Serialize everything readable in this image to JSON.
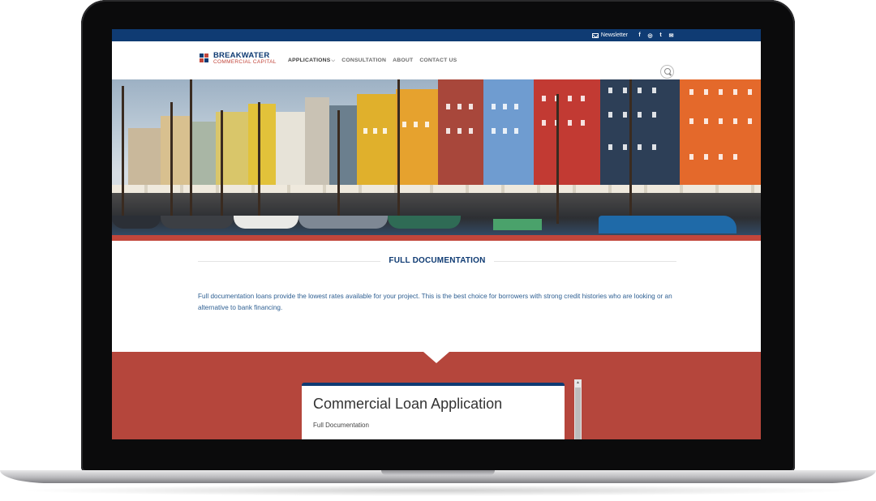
{
  "topbar": {
    "newsletter_label": "Newsletter",
    "social": [
      "f",
      "◎",
      "t",
      "✉"
    ]
  },
  "brand": {
    "name": "BREAKWATER",
    "tagline": "COMMERCIAL CAPITAL"
  },
  "nav": {
    "items": [
      {
        "label": "APPLICATIONS"
      },
      {
        "label": "CONSULTATION"
      },
      {
        "label": "ABOUT"
      },
      {
        "label": "CONTACT US"
      }
    ]
  },
  "section": {
    "title": "FULL DOCUMENTATION",
    "description": "Full documentation loans provide the lowest rates available for your project. This is the best choice for borrowers with strong credit histories who are looking or an alternative to bank financing."
  },
  "form": {
    "title": "Commercial Loan Application",
    "subtitle": "Full Documentation"
  },
  "colors": {
    "navy": "#0f3b73",
    "brand_red": "#c2463b",
    "section_red": "#b5463c"
  }
}
